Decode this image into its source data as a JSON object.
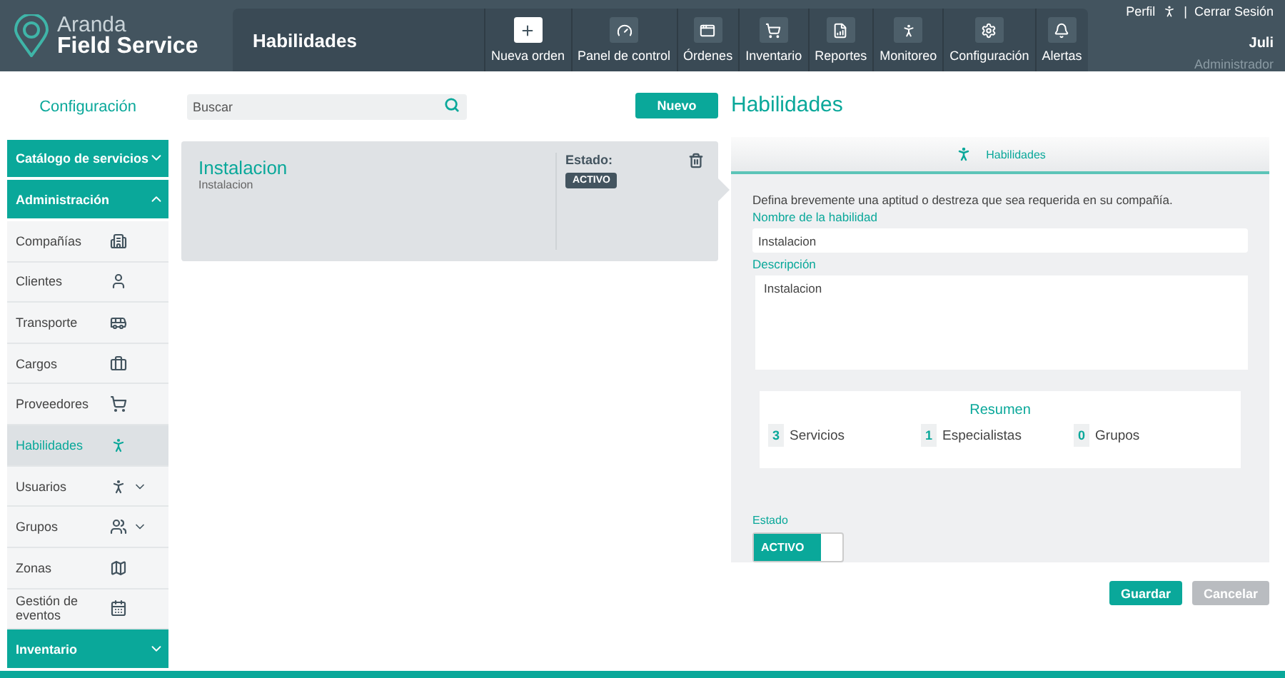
{
  "header": {
    "logo_top": "Aranda",
    "logo_bottom": "Field Service",
    "page_title": "Habilidades",
    "nav": [
      {
        "label": "Nueva orden",
        "highlighted": true
      },
      {
        "label": "Panel de control",
        "highlighted": false
      },
      {
        "label": "Órdenes",
        "highlighted": false
      },
      {
        "label": "Inventario",
        "highlighted": false
      },
      {
        "label": "Reportes",
        "highlighted": false
      },
      {
        "label": "Monitoreo",
        "highlighted": false
      },
      {
        "label": "Configuración",
        "highlighted": false
      },
      {
        "label": "Alertas",
        "highlighted": false
      }
    ],
    "user": {
      "profile": "Perfil",
      "separator": "|",
      "logout": "Cerrar Sesión",
      "name": "Juli",
      "role": "Administrador"
    }
  },
  "sidebar": {
    "title": "Configuración",
    "sections": [
      {
        "label": "Catálogo de servicios",
        "expanded": false
      },
      {
        "label": "Administración",
        "expanded": true,
        "items": [
          {
            "label": "Compañías",
            "selected": false,
            "has_submenu": false
          },
          {
            "label": "Clientes",
            "selected": false,
            "has_submenu": false
          },
          {
            "label": "Transporte",
            "selected": false,
            "has_submenu": false
          },
          {
            "label": "Cargos",
            "selected": false,
            "has_submenu": false
          },
          {
            "label": "Proveedores",
            "selected": false,
            "has_submenu": false
          },
          {
            "label": "Habilidades",
            "selected": true,
            "has_submenu": false
          },
          {
            "label": "Usuarios",
            "selected": false,
            "has_submenu": true
          },
          {
            "label": "Grupos",
            "selected": false,
            "has_submenu": true
          },
          {
            "label": "Zonas",
            "selected": false,
            "has_submenu": false
          },
          {
            "label": "Gestión de eventos",
            "selected": false,
            "has_submenu": false
          }
        ]
      },
      {
        "label": "Inventario",
        "expanded": false
      }
    ]
  },
  "list": {
    "search": {
      "placeholder": "Buscar"
    },
    "new_button": "Nuevo",
    "cards": [
      {
        "title": "Instalacion",
        "subtitle": "Instalacion",
        "status_label": "Estado:",
        "status": "ACTIVO",
        "selected": true
      }
    ]
  },
  "detail": {
    "heading": "Habilidades",
    "tab": "Habilidades",
    "intro": "Defina brevemente una aptitud o destreza que sea requerida en su compañía.",
    "name_label": "Nombre de la habilidad",
    "name_value": "Instalacion",
    "description_label": "Descripción",
    "description_value": "Instalacion",
    "summary": {
      "title": "Resumen",
      "counts": [
        {
          "value": "3",
          "label": "Servicios"
        },
        {
          "value": "1",
          "label": "Especialistas"
        },
        {
          "value": "0",
          "label": "Grupos"
        }
      ]
    },
    "state_label": "Estado",
    "toggle": {
      "label": "ACTIVO",
      "on": true
    },
    "save_button": "Guardar",
    "cancel_button": {
      "label": "Cancelar",
      "disabled": true
    }
  }
}
